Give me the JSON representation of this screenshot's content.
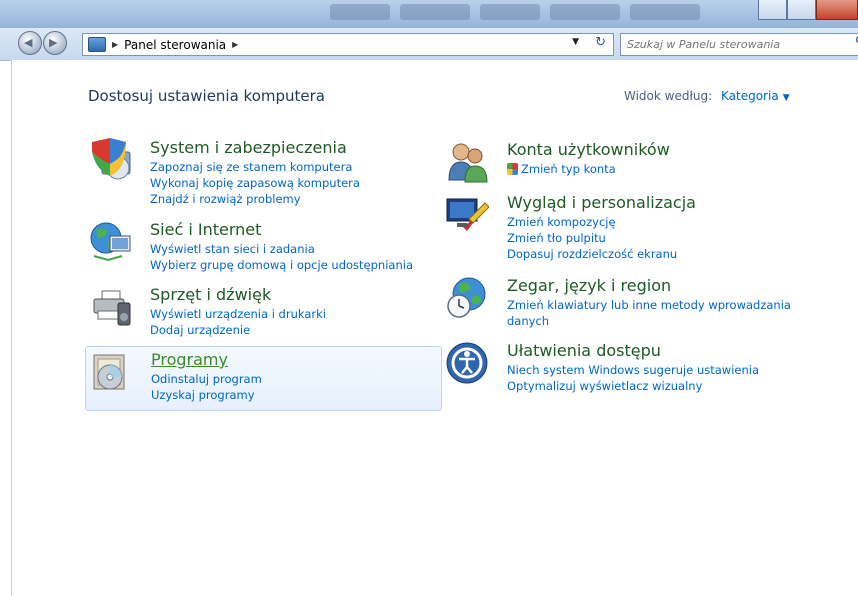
{
  "address_bar": {
    "breadcrumb": "Panel sterowania"
  },
  "search": {
    "placeholder": "Szukaj w Panelu sterowania"
  },
  "header": {
    "title": "Dostosuj ustawienia komputera",
    "view_by_label": "Widok według:",
    "view_by_value": "Kategoria"
  },
  "categories": [
    {
      "title": "System i zabezpieczenia",
      "icon": "shield-computer-icon",
      "links": [
        "Zapoznaj się ze stanem komputera",
        "Wykonaj kopię zapasową komputera",
        "Znajdź i rozwiąż problemy"
      ]
    },
    {
      "title": "Sieć i Internet",
      "icon": "network-globe-icon",
      "links": [
        "Wyświetl stan sieci i zadania",
        "Wybierz grupę domową i opcje udostępniania"
      ]
    },
    {
      "title": "Sprzęt i dźwięk",
      "icon": "printer-speaker-icon",
      "links": [
        "Wyświetl urządzenia i drukarki",
        "Dodaj urządzenie"
      ]
    },
    {
      "title": "Programy",
      "icon": "programs-disc-icon",
      "links": [
        "Odinstaluj program",
        "Uzyskaj programy"
      ]
    },
    {
      "title": "Konta użytkowników",
      "icon": "users-icon",
      "links": [
        "Zmień typ konta"
      ]
    },
    {
      "title": "Wygląd i personalizacja",
      "icon": "appearance-monitor-icon",
      "links": [
        "Zmień kompozycję",
        "Zmień tło pulpitu",
        "Dopasuj rozdzielczość ekranu"
      ]
    },
    {
      "title": "Zegar, język i region",
      "icon": "clock-globe-icon",
      "links": [
        "Zmień klawiatury lub inne metody wprowadzania",
        "danych"
      ]
    },
    {
      "title": "Ułatwienia dostępu",
      "icon": "accessibility-icon",
      "links": [
        "Niech system Windows sugeruje ustawienia",
        "Optymalizuj wyświetlacz wizualny"
      ]
    }
  ],
  "colors": {
    "link": "#0066cc",
    "category_title": "#1e5a25",
    "highlight_border": "#b8d6fb"
  }
}
